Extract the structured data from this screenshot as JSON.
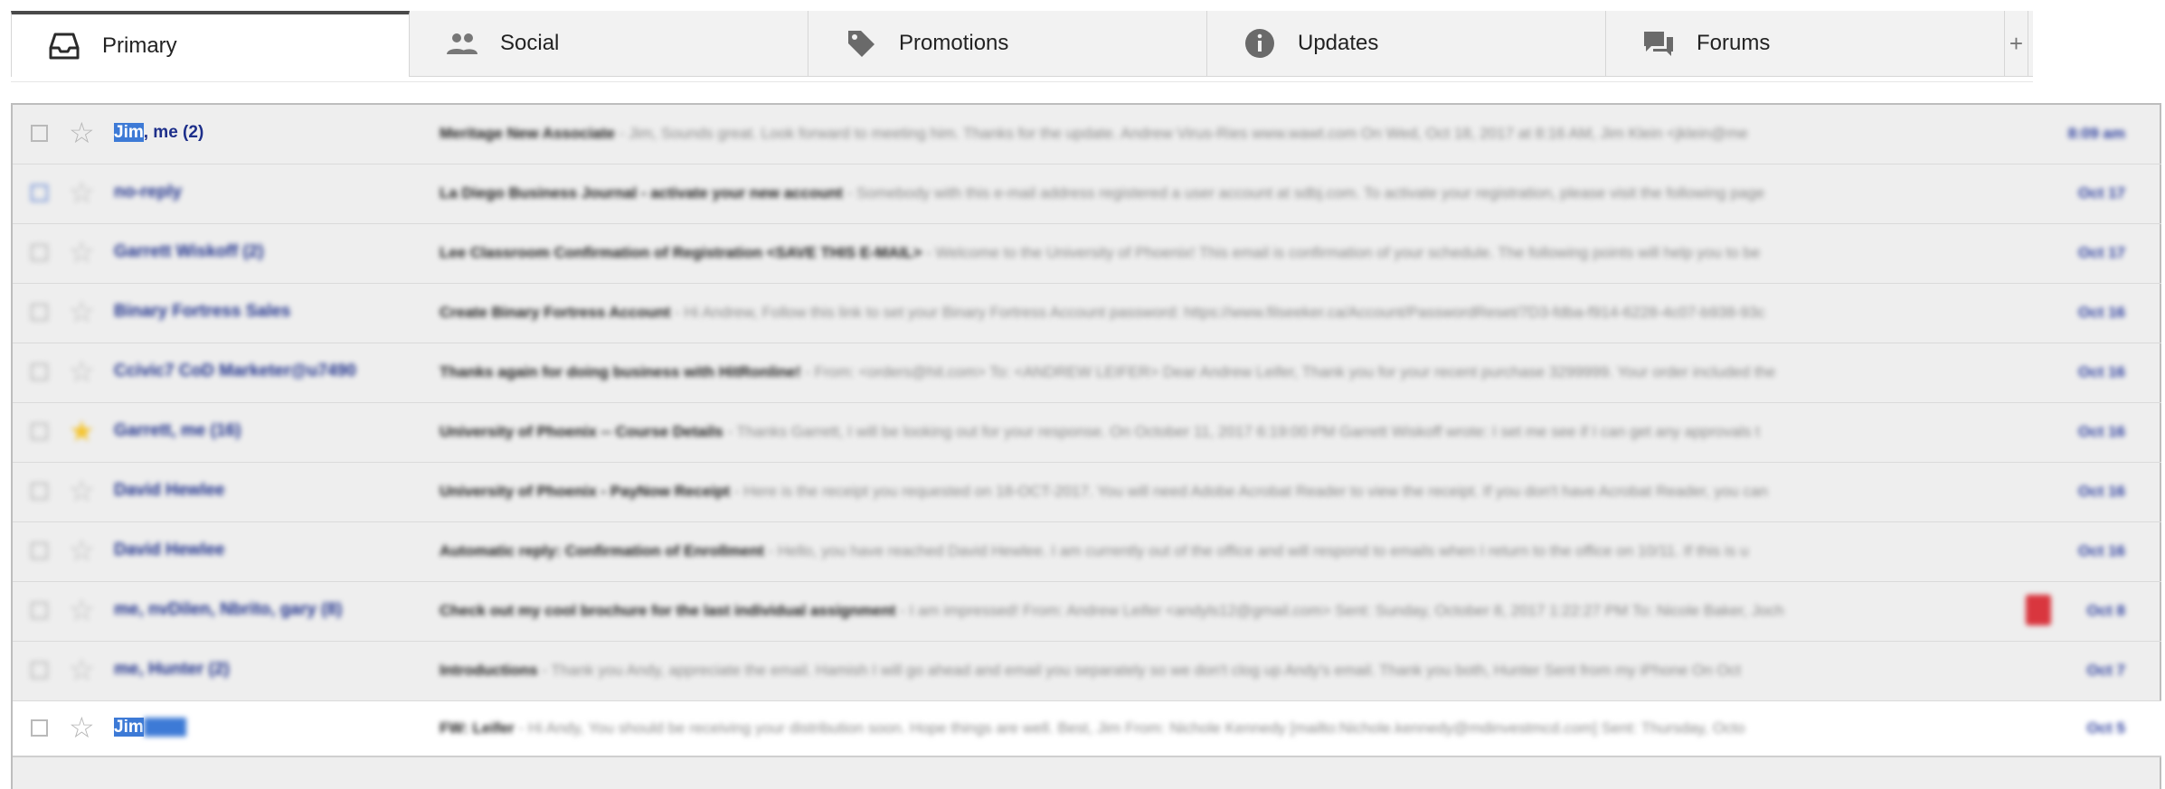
{
  "tabs": [
    {
      "label": "Primary",
      "icon": "inbox-icon",
      "active": true
    },
    {
      "label": "Social",
      "icon": "people-icon",
      "active": false
    },
    {
      "label": "Promotions",
      "icon": "tag-icon",
      "active": false
    },
    {
      "label": "Updates",
      "icon": "info-icon",
      "active": false
    },
    {
      "label": "Forums",
      "icon": "forum-icon",
      "active": false
    }
  ],
  "add_tab_label": "+",
  "emails": [
    {
      "sender_highlight": "Jim",
      "sender_rest": ", me (2)",
      "starred": false,
      "subject": "Meritage New Associate",
      "snippet": " - Jim, Sounds great. Look forward to meeting him. Thanks for the update. Andrew Virus-Ries www.wawt.com On Wed, Oct 18, 2017 at 8:16 AM, Jim Klein <jklein@me",
      "date": "8:09 am",
      "blurred": false
    },
    {
      "sender_highlight": "",
      "sender_rest": "no-reply",
      "starred": false,
      "subject": "La Diego Business Journal - activate your new account",
      "snippet": " - Somebody with this e-mail address registered a user account at sdbj.com. To activate your registration, please visit the following page",
      "date": "Oct 17",
      "blurred": true
    },
    {
      "sender_highlight": "",
      "sender_rest": "Garrett Wiskoff (2)",
      "starred": false,
      "subject": "Lee Classroom Confirmation of Registration <SAVE THIS E-MAIL>",
      "snippet": " - Welcome to the University of Phoenix! This email is confirmation of your schedule. The following points will help you to be",
      "date": "Oct 17",
      "blurred": true
    },
    {
      "sender_highlight": "",
      "sender_rest": "Binary Fortress Sales",
      "starred": false,
      "subject": "Create Binary Fortress Account",
      "snippet": " - Hi Andrew, Follow this link to set your Binary Fortress Account password: https://www.filseeker.ca/Account/PasswordReset/7D3-fdba-f914-6228-4c07-b938-93c",
      "date": "Oct 16",
      "blurred": true
    },
    {
      "sender_highlight": "",
      "sender_rest": "Ccivic7 CoD Marketer@u7490",
      "starred": false,
      "subject": "Thanks again for doing business with HitRonline!",
      "snippet": " - From: <orders@hit.com> To: <ANDREW LEIFER> Dear Andrew Leifer, Thank you for your recent purchase 3299999. Your order included the",
      "date": "Oct 16",
      "blurred": true
    },
    {
      "sender_highlight": "",
      "sender_rest": "Garrett, me (16)",
      "starred": true,
      "subject": "University of Phoenix -- Course Details",
      "snippet": " - Thanks Garrett, I will be looking out for your response. On October 11, 2017 6:19:00 PM Garrett Wiskoff wrote: I set me see if I can get any approvals t",
      "date": "Oct 16",
      "blurred": true
    },
    {
      "sender_highlight": "",
      "sender_rest": "David Hewlee",
      "starred": false,
      "subject": "University of Phoenix - PayNow Receipt",
      "snippet": " - Here is the receipt you requested on 18-OCT-2017. You will need Adobe Acrobat Reader to view the receipt. If you don't have Acrobat Reader, you can",
      "date": "Oct 16",
      "blurred": true
    },
    {
      "sender_highlight": "",
      "sender_rest": "David Hewlee",
      "starred": false,
      "subject": "Automatic reply: Confirmation of Enrollment",
      "snippet": " - Hello, you have reached David Hewlee. I am currently out of the office and will respond to emails when I return to the office on 10/11. If this is u",
      "date": "Oct 16",
      "blurred": true
    },
    {
      "sender_highlight": "",
      "sender_rest": "me, nvDilen, Nbrito, gary (8)",
      "starred": false,
      "subject": "Check out my cool brochure for the last individual assignment",
      "snippet": " - I am impressed! From: Andrew Leifer <andyls12@gmail.com> Sent: Sunday, October 8, 2017 1:22:27 PM To: Nicole Baker, Joch",
      "date": "Oct 8",
      "blurred": true
    },
    {
      "sender_highlight": "",
      "sender_rest": "me, Hunter (2)",
      "starred": false,
      "subject": "Introductions",
      "snippet": " - Thank you Andy, appreciate the email. Hamish I will go ahead and email you separately so we don't clog up Andy's email. Thank you both, Hunter Sent from my iPhone On Oct",
      "date": "Oct 7",
      "blurred": true
    },
    {
      "sender_highlight": "Jim",
      "sender_rest": "",
      "starred": false,
      "subject": "FW: Leifer",
      "snippet": " - Hi Andy, You should be receiving your distribution soon. Hope things are well. Best, Jim From: Nichole Kennedy [mailto:Nichole.kennedy@mdinvestmcd.com] Sent: Thursday, Octo",
      "date": "Oct 5",
      "blurred": true
    }
  ],
  "colors": {
    "sender": "#1d2f8a",
    "selection": "#3d7ad6",
    "star_yellow": "#f4c430",
    "label_red": "#d9363e"
  }
}
